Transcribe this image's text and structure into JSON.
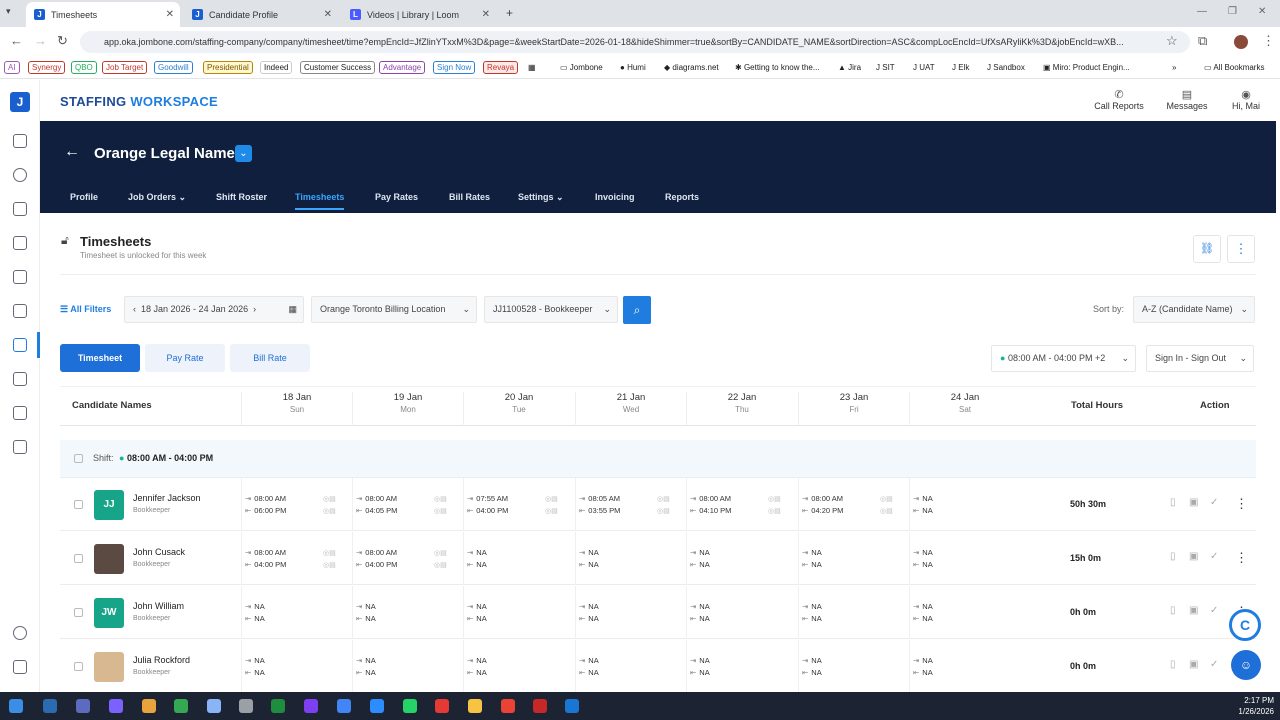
{
  "browser": {
    "tabs": [
      {
        "title": "Timesheets"
      },
      {
        "title": "Candidate Profile"
      },
      {
        "title": "Videos | Library | Loom"
      }
    ],
    "url": "app.oka.jombone.com/staffing-company/company/timesheet/time?empEncId=JfZlinYTxxM%3D&page=&weekStartDate=2026-01-18&hideShimmer=true&sortBy=CANDIDATE_NAME&sortDirection=ASC&compLocEncId=UfXsARyliKk%3D&jobEncId=wXB...",
    "bookmarks_tags": [
      "AI",
      "Synergy",
      "QBO",
      "Job Target",
      "Goodwill",
      "Presidential",
      "Indeed",
      "Customer Success",
      "Advantage",
      "Sign Now",
      "Revaya"
    ],
    "bookmarks_links": [
      "Jombone",
      "Humi",
      "diagrams.net",
      "Getting to know the...",
      "Jira",
      "SIT",
      "UAT",
      "Elk",
      "Sandbox",
      "Miro: Product Engin..."
    ],
    "all_bookmarks": "All Bookmarks"
  },
  "app": {
    "brand_a": "STAFFING",
    "brand_b": " WORKSPACE",
    "top_nav": [
      {
        "label": "Call Reports",
        "icon": "phone-icon"
      },
      {
        "label": "Messages",
        "icon": "messages-icon"
      },
      {
        "label": "Hi, Mai",
        "icon": "user-icon"
      }
    ],
    "company": "Orange Legal Name",
    "tabs": [
      "Profile",
      "Job Orders",
      "Shift Roster",
      "Timesheets",
      "Pay Rates",
      "Bill Rates",
      "Settings",
      "Invoicing",
      "Reports"
    ],
    "active_tab": "Timesheets"
  },
  "page": {
    "title": "Timesheets",
    "subtitle": "Timesheet is unlocked for this week",
    "all_filters": "All Filters",
    "date_range": "18 Jan 2026 - 24 Jan 2026",
    "location": "Orange Toronto Billing Location",
    "job": "JJ1100528 - Bookkeeper",
    "sort_label": "Sort by:",
    "sort_value": "A-Z (Candidate Name)",
    "view_tabs": [
      "Timesheet",
      "Pay Rate",
      "Bill Rate"
    ],
    "shift_filter": "08:00 AM - 04:00 PM +2",
    "mode_filter": "Sign In - Sign Out"
  },
  "table": {
    "col_names": "Candidate Names",
    "days": [
      {
        "d": "18 Jan",
        "w": "Sun"
      },
      {
        "d": "19 Jan",
        "w": "Mon"
      },
      {
        "d": "20 Jan",
        "w": "Tue"
      },
      {
        "d": "21 Jan",
        "w": "Wed"
      },
      {
        "d": "22 Jan",
        "w": "Thu"
      },
      {
        "d": "23 Jan",
        "w": "Fri"
      },
      {
        "d": "24 Jan",
        "w": "Sat"
      }
    ],
    "col_total": "Total Hours",
    "col_action": "Action",
    "shift_label": "Shift:",
    "shift_value": "08:00 AM - 04:00 PM",
    "rows": [
      {
        "name": "Jennifer Jackson",
        "role": "Bookkeeper",
        "initials": "JJ",
        "avatar": "teal",
        "times": [
          [
            "08:00 AM",
            "06:00 PM"
          ],
          [
            "08:00 AM",
            "04:05 PM"
          ],
          [
            "07:55 AM",
            "04:00 PM"
          ],
          [
            "08:05 AM",
            "03:55 PM"
          ],
          [
            "08:00 AM",
            "04:10 PM"
          ],
          [
            "08:00 AM",
            "04:20 PM"
          ],
          [
            "NA",
            "NA"
          ]
        ],
        "total": "50h 30m"
      },
      {
        "name": "John Cusack",
        "role": "Bookkeeper",
        "initials": "",
        "avatar": "photo",
        "times": [
          [
            "08:00 AM",
            "04:00 PM"
          ],
          [
            "08:00 AM",
            "04:00 PM"
          ],
          [
            "NA",
            "NA"
          ],
          [
            "NA",
            "NA"
          ],
          [
            "NA",
            "NA"
          ],
          [
            "NA",
            "NA"
          ],
          [
            "NA",
            "NA"
          ]
        ],
        "total": "15h 0m"
      },
      {
        "name": "John William",
        "role": "Bookkeeper",
        "initials": "JW",
        "avatar": "teal",
        "times": [
          [
            "NA",
            "NA"
          ],
          [
            "NA",
            "NA"
          ],
          [
            "NA",
            "NA"
          ],
          [
            "NA",
            "NA"
          ],
          [
            "NA",
            "NA"
          ],
          [
            "NA",
            "NA"
          ],
          [
            "NA",
            "NA"
          ]
        ],
        "total": "0h 0m"
      },
      {
        "name": "Julia Rockford",
        "role": "Bookkeeper",
        "initials": "",
        "avatar": "photo2",
        "times": [
          [
            "NA",
            "NA"
          ],
          [
            "NA",
            "NA"
          ],
          [
            "NA",
            "NA"
          ],
          [
            "NA",
            "NA"
          ],
          [
            "NA",
            "NA"
          ],
          [
            "NA",
            "NA"
          ],
          [
            "NA",
            "NA"
          ]
        ],
        "total": "0h 0m"
      }
    ]
  },
  "taskbar": {
    "time": "2:17 PM",
    "date": "1/26/2026"
  }
}
